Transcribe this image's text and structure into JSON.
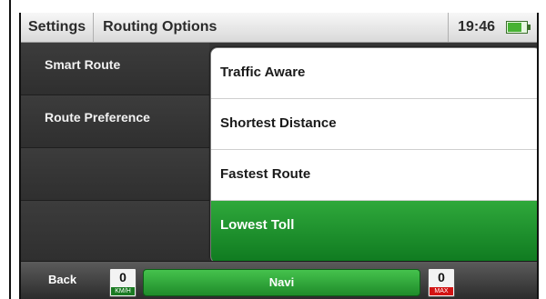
{
  "header": {
    "settings_label": "Settings",
    "title": "Routing Options",
    "clock": "19:46",
    "battery_icon": "battery-charging-icon"
  },
  "left_menu": {
    "items": [
      {
        "label": "Smart Route"
      },
      {
        "label": "Route Preference"
      },
      {
        "label": ""
      },
      {
        "label": ""
      }
    ]
  },
  "dropdown": {
    "options": [
      {
        "label": "Traffic Aware",
        "selected": false
      },
      {
        "label": "Shortest Distance",
        "selected": false
      },
      {
        "label": "Fastest Route",
        "selected": false
      },
      {
        "label": "Lowest Toll",
        "selected": true
      }
    ]
  },
  "footer": {
    "back_label": "Back",
    "speed_value": "0",
    "speed_unit": "KM/H",
    "navi_label": "Navi",
    "max_value": "0",
    "max_unit": "MAX"
  },
  "colors": {
    "selected_green": "#1f8c2a",
    "max_red": "#d21414"
  }
}
